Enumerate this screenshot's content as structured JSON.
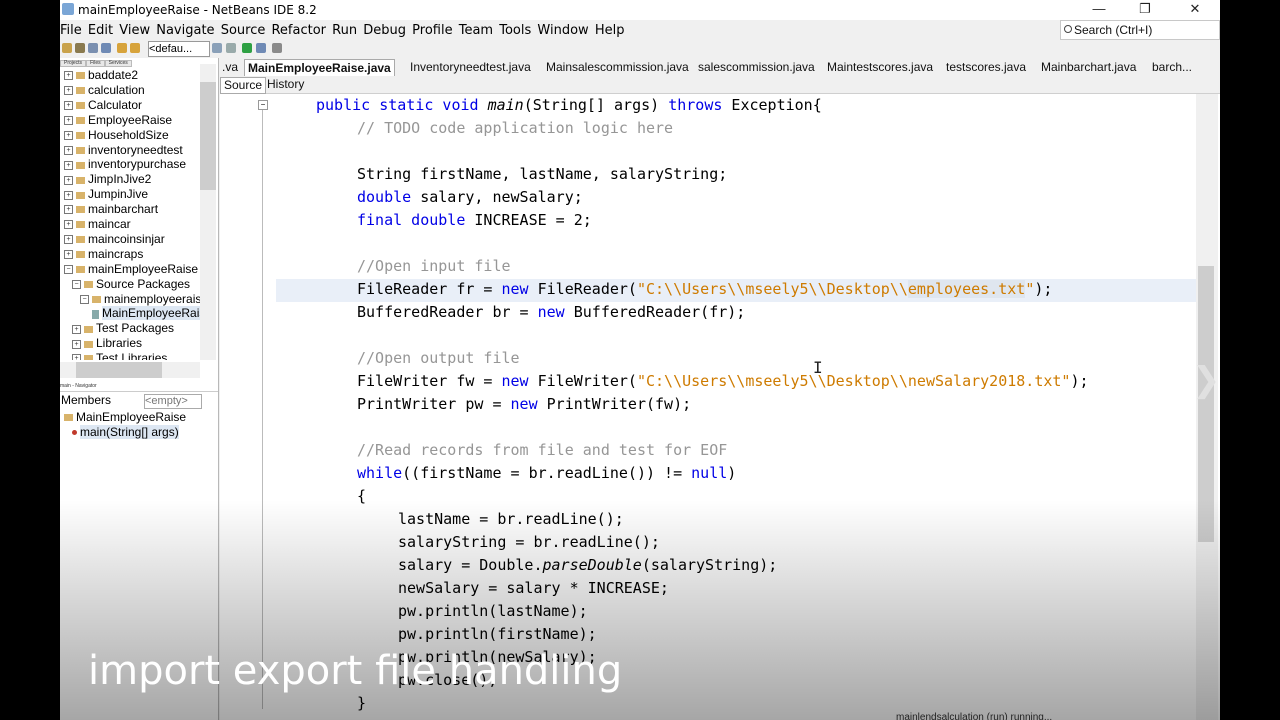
{
  "window": {
    "title": "mainEmployeeRaise - NetBeans IDE 8.2"
  },
  "window_controls": {
    "minimize": "—",
    "restore": "❐",
    "close": "✕"
  },
  "menu": [
    "File",
    "Edit",
    "View",
    "Navigate",
    "Source",
    "Refactor",
    "Run",
    "Debug",
    "Profile",
    "Team",
    "Tools",
    "Window",
    "Help"
  ],
  "search": {
    "placeholder": "Search (Ctrl+I)"
  },
  "toolbar": {
    "config": "<defau..."
  },
  "projects_panel": {
    "tabs": [
      "Projects",
      "Files",
      "Services"
    ],
    "items": [
      {
        "label": "baddate2",
        "level": 0,
        "exp": "+"
      },
      {
        "label": "calculation",
        "level": 0,
        "exp": "+"
      },
      {
        "label": "Calculator",
        "level": 0,
        "exp": "+"
      },
      {
        "label": "EmployeeRaise",
        "level": 0,
        "exp": "+"
      },
      {
        "label": "HouseholdSize",
        "level": 0,
        "exp": "+"
      },
      {
        "label": "inventoryneedtest",
        "level": 0,
        "exp": "+"
      },
      {
        "label": "inventorypurchase",
        "level": 0,
        "exp": "+"
      },
      {
        "label": "JimpInJive2",
        "level": 0,
        "exp": "+"
      },
      {
        "label": "JumpinJive",
        "level": 0,
        "exp": "+"
      },
      {
        "label": "mainbarchart",
        "level": 0,
        "exp": "+"
      },
      {
        "label": "maincar",
        "level": 0,
        "exp": "+"
      },
      {
        "label": "maincoinsinjar",
        "level": 0,
        "exp": "+"
      },
      {
        "label": "maincraps",
        "level": 0,
        "exp": "+"
      },
      {
        "label": "mainEmployeeRaise",
        "level": 0,
        "exp": "−"
      },
      {
        "label": "Source Packages",
        "level": 1,
        "exp": "−"
      },
      {
        "label": "mainemployeeraise",
        "level": 2,
        "exp": "−"
      },
      {
        "label": "MainEmployeeRaise",
        "level": 3,
        "exp": ""
      },
      {
        "label": "Test Packages",
        "level": 1,
        "exp": "+"
      },
      {
        "label": "Libraries",
        "level": 1,
        "exp": "+"
      },
      {
        "label": "Test Libraries",
        "level": 1,
        "exp": "+"
      }
    ]
  },
  "navigator": {
    "header": "main - Navigator",
    "members_label": "Members",
    "filter": "<empty>",
    "items": [
      {
        "label": "MainEmployeeRaise",
        "level": 0
      },
      {
        "label": "main(String[] args)",
        "level": 1
      }
    ]
  },
  "editor_tabs": [
    ".va",
    "MainEmployeeRaise.java",
    "Inventoryneedtest.java",
    "Mainsalescommission.java",
    "salescommission.java",
    "Maintestscores.java",
    "testscores.java",
    "Mainbarchart.java",
    "barch..."
  ],
  "editor_views": {
    "source": "Source",
    "history": "History"
  },
  "code": {
    "l1_kw1": "public static void ",
    "l1_main": "main",
    "l1_sig": "(String[] args) ",
    "l1_throws": "throws",
    "l1_exc": " Exception{",
    "l2": "// TODO code application logic here",
    "l3": "String firstName, lastName, salaryString;",
    "l4_kw": "double",
    "l4": " salary, newSalary;",
    "l5_kw": "final double",
    "l5": " INCREASE = 2;",
    "l6": "//Open input file",
    "l7_a": "FileReader fr = ",
    "l7_new": "new",
    "l7_b": " FileReader(",
    "l7_s1": "\"C:\\\\Users\\\\mseely5\\\\Desktop\\\\",
    "l7_s2": "employees.txt",
    "l7_s3": "\"",
    "l7_c": ");",
    "l8_a": "BufferedReader br = ",
    "l8_new": "new",
    "l8_b": " BufferedReader(fr);",
    "l9": "//Open output file",
    "l10_a": "FileWriter fw = ",
    "l10_new": "new",
    "l10_b": " FileWriter(",
    "l10_s": "\"C:\\\\Users\\\\mseely5\\\\Desktop\\\\newSalary2018.txt\"",
    "l10_c": ");",
    "l11_a": "PrintWriter pw = ",
    "l11_new": "new",
    "l11_b": " PrintWriter(fw);",
    "l12": "//Read records from file and test for EOF",
    "l13_kw": "while",
    "l13_a": "((firstName = br.readLine()) != ",
    "l13_null": "null",
    "l13_b": ")",
    "l14": "{",
    "l15": "lastName = br.readLine();",
    "l16": "salaryString = br.readLine();",
    "l17_a": "salary = Double.",
    "l17_it": "parseDouble",
    "l17_b": "(salaryString);",
    "l18": "newSalary = salary * INCREASE;",
    "l19": "pw.println(lastName);",
    "l20": "pw.println(firstName);",
    "l21": "pw.println(newSalary);",
    "l22": "pw.close();",
    "l23": "}"
  },
  "caption": "import export file handling",
  "status": "mainlendsalculation (run)  running..."
}
